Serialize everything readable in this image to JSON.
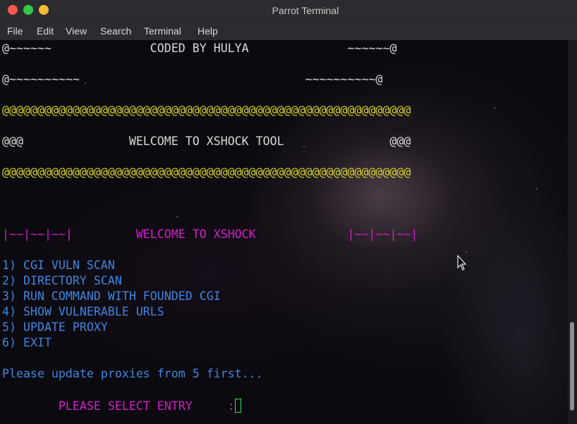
{
  "window": {
    "title": "Parrot Terminal"
  },
  "menu": [
    "File",
    "Edit",
    "View",
    "Search",
    "Terminal",
    "Help"
  ],
  "terminal": {
    "lines": {
      "coded_by": "@~~~~~~              CODED BY HULYA              ~~~~~~@",
      "tilde_border": "@~~~~~~~~~~                                ~~~~~~~~~~@",
      "at_row_1": "@@@@@@@@@@@@@@@@@@@@@@@@@@@@@@@@@@@@@@@@@@@@@@@@@@@@@@@@@@",
      "welcome_tool": "@@@               WELCOME TO XSHOCK TOOL               @@@",
      "at_row_2": "@@@@@@@@@@@@@@@@@@@@@@@@@@@@@@@@@@@@@@@@@@@@@@@@@@@@@@@@@@",
      "welcome_banner": "|~~|~~|~~|         WELCOME TO XSHOCK             |~~|~~|~~|"
    },
    "menu_options": [
      "1) CGI VULN SCAN",
      "2) DIRECTORY SCAN",
      "3) RUN COMMAND WITH FOUNDED CGI",
      "4) SHOW VULNERABLE URLS",
      "5) UPDATE PROXY",
      "6) EXIT"
    ],
    "notice": "Please update proxies from 5 first...",
    "prompt": "        PLEASE SELECT ENTRY     :"
  },
  "colors": {
    "yellow": "#d6d02a",
    "white": "#d9d9d9",
    "magenta": "#d21fc9",
    "blue": "#3e86e0",
    "cursor": "#2ee85c"
  }
}
